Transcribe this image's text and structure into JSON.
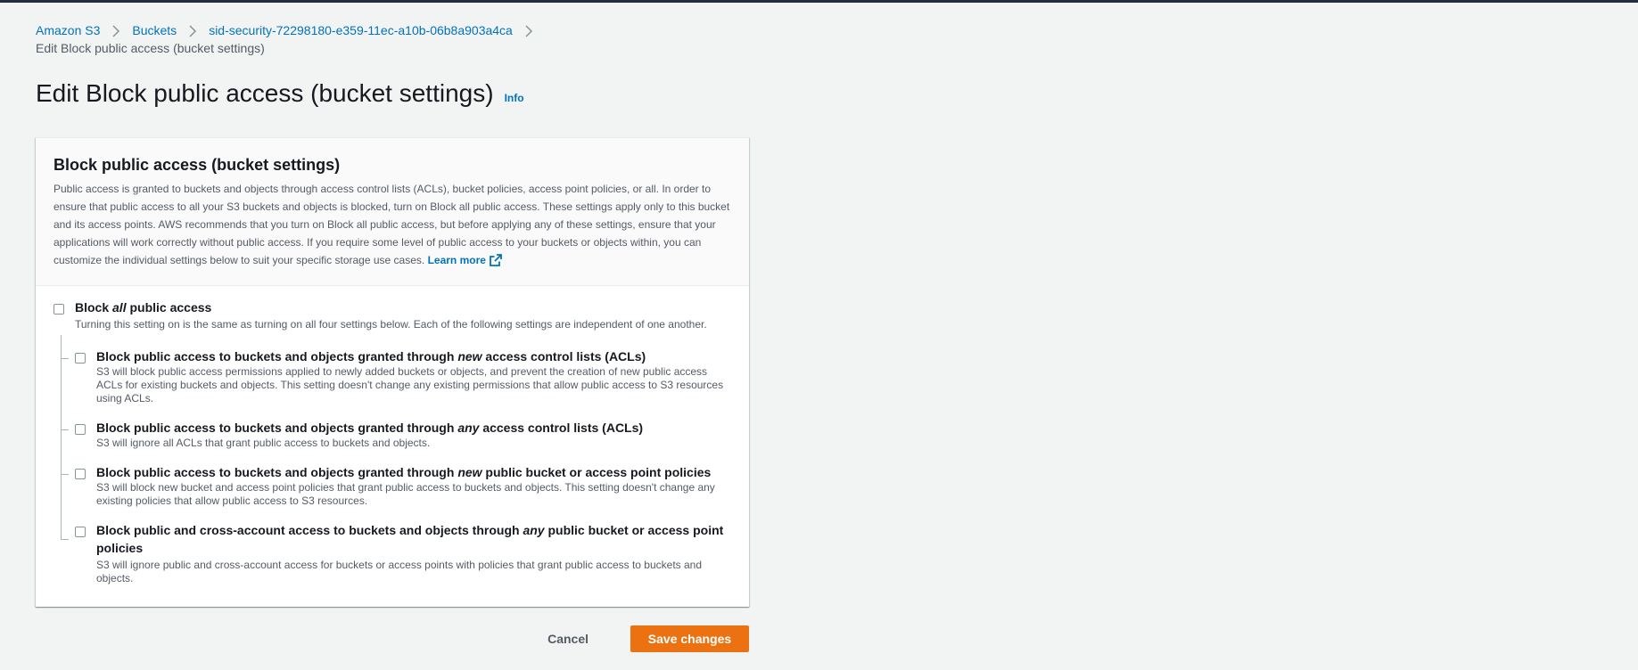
{
  "colors": {
    "accent": "#0073bb",
    "primary_button": "#ec7211",
    "background": "#f2f3f3",
    "top_bar": "#232f3e"
  },
  "breadcrumbs": {
    "items": [
      "Amazon S3",
      "Buckets",
      "sid-security-72298180-e359-11ec-a10b-06b8a903a4ca"
    ],
    "current": "Edit Block public access (bucket settings)"
  },
  "page": {
    "title": "Edit Block public access (bucket settings)",
    "info_label": "Info"
  },
  "panel": {
    "title": "Block public access (bucket settings)",
    "description": "Public access is granted to buckets and objects through access control lists (ACLs), bucket policies, access point policies, or all. In order to ensure that public access to all your S3 buckets and objects is blocked, turn on Block all public access. These settings apply only to this bucket and its access points. AWS recommends that you turn on Block all public access, but before applying any of these settings, ensure that your applications will work correctly without public access. If you require some level of public access to your buckets or objects within, you can customize the individual settings below to suit your specific storage use cases.",
    "learn_more": "Learn more"
  },
  "block_all": {
    "title_pre": "Block ",
    "title_em": "all",
    "title_post": " public access",
    "description": "Turning this setting on is the same as turning on all four settings below. Each of the following settings are independent of one another.",
    "checked": false
  },
  "options": [
    {
      "title_pre": "Block public access to buckets and objects granted through ",
      "title_em": "new",
      "title_post": " access control lists (ACLs)",
      "description": "S3 will block public access permissions applied to newly added buckets or objects, and prevent the creation of new public access ACLs for existing buckets and objects. This setting doesn't change any existing permissions that allow public access to S3 resources using ACLs.",
      "checked": false
    },
    {
      "title_pre": "Block public access to buckets and objects granted through ",
      "title_em": "any",
      "title_post": " access control lists (ACLs)",
      "description": "S3 will ignore all ACLs that grant public access to buckets and objects.",
      "checked": false
    },
    {
      "title_pre": "Block public access to buckets and objects granted through ",
      "title_em": "new",
      "title_post": " public bucket or access point policies",
      "description": "S3 will block new bucket and access point policies that grant public access to buckets and objects. This setting doesn't change any existing policies that allow public access to S3 resources.",
      "checked": false
    },
    {
      "title_pre": "Block public and cross-account access to buckets and objects through ",
      "title_em": "any",
      "title_post": " public bucket or access point policies",
      "description": "S3 will ignore public and cross-account access for buckets or access points with policies that grant public access to buckets and objects.",
      "checked": false
    }
  ],
  "actions": {
    "cancel_label": "Cancel",
    "save_label": "Save changes"
  }
}
